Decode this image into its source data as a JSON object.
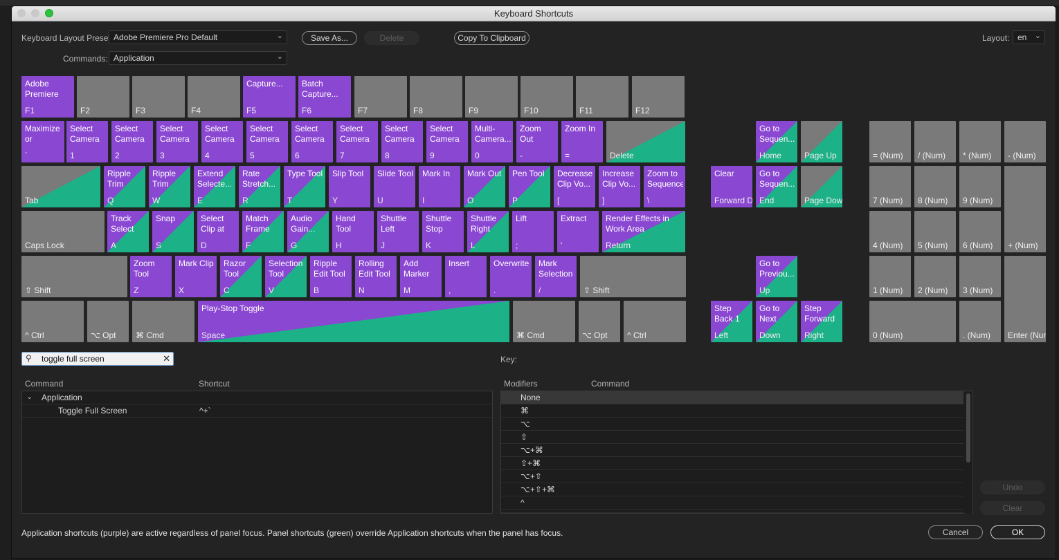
{
  "window": {
    "title": "Keyboard Shortcuts"
  },
  "toolbar": {
    "preset_label": "Keyboard Layout Preset:",
    "preset_value": "Adobe Premiere Pro Default",
    "commands_label": "Commands:",
    "commands_value": "Application",
    "save_as": "Save As...",
    "delete": "Delete",
    "copy_to_clipboard": "Copy To Clipboard",
    "layout_label": "Layout:",
    "layout_value": "en"
  },
  "colors": {
    "application": "#8a47d2",
    "panel": "#1cb187",
    "unassigned": "#7a7a7a"
  },
  "keys": [
    {
      "cmd": "Adobe Premiere",
      "label": "F1",
      "type": "app"
    },
    {
      "cmd": "",
      "label": "F2",
      "type": "none"
    },
    {
      "cmd": "",
      "label": "F3",
      "type": "none"
    },
    {
      "cmd": "",
      "label": "F4",
      "type": "none"
    },
    {
      "cmd": "Capture...",
      "label": "F5",
      "type": "app"
    },
    {
      "cmd": "Batch Capture...",
      "label": "F6",
      "type": "app"
    },
    {
      "cmd": "",
      "label": "F7",
      "type": "none"
    },
    {
      "cmd": "",
      "label": "F8",
      "type": "none"
    },
    {
      "cmd": "",
      "label": "F9",
      "type": "none"
    },
    {
      "cmd": "",
      "label": "F10",
      "type": "none"
    },
    {
      "cmd": "",
      "label": "F11",
      "type": "none"
    },
    {
      "cmd": "",
      "label": "F12",
      "type": "none"
    },
    {
      "cmd": "Maximize or",
      "label": "`",
      "type": "app"
    },
    {
      "cmd": "Select Camera 1",
      "label": "1",
      "type": "app"
    },
    {
      "cmd": "Select Camera 2",
      "label": "2",
      "type": "app"
    },
    {
      "cmd": "Select Camera 3",
      "label": "3",
      "type": "app"
    },
    {
      "cmd": "Select Camera 4",
      "label": "4",
      "type": "app"
    },
    {
      "cmd": "Select Camera 5",
      "label": "5",
      "type": "app"
    },
    {
      "cmd": "Select Camera 6",
      "label": "6",
      "type": "app"
    },
    {
      "cmd": "Select Camera 7",
      "label": "7",
      "type": "app"
    },
    {
      "cmd": "Select Camera 8",
      "label": "8",
      "type": "app"
    },
    {
      "cmd": "Select Camera 9",
      "label": "9",
      "type": "app"
    },
    {
      "cmd": "Multi-Camera...",
      "label": "0",
      "type": "app"
    },
    {
      "cmd": "Zoom Out",
      "label": "-",
      "type": "app"
    },
    {
      "cmd": "Zoom In",
      "label": "=",
      "type": "app"
    },
    {
      "cmd": "",
      "label": "Delete",
      "type": "panel"
    },
    {
      "cmd": "",
      "label": "Tab",
      "type": "panel"
    },
    {
      "cmd": "Ripple Trim",
      "label": "Q",
      "type": "mixed"
    },
    {
      "cmd": "Ripple Trim",
      "label": "W",
      "type": "mixed"
    },
    {
      "cmd": "Extend Selecte...",
      "label": "E",
      "type": "mixed"
    },
    {
      "cmd": "Rate Stretch...",
      "label": "R",
      "type": "mixed"
    },
    {
      "cmd": "Type Tool",
      "label": "T",
      "type": "mixed"
    },
    {
      "cmd": "Slip Tool",
      "label": "Y",
      "type": "app"
    },
    {
      "cmd": "Slide Tool",
      "label": "U",
      "type": "app"
    },
    {
      "cmd": "Mark In",
      "label": "I",
      "type": "app"
    },
    {
      "cmd": "Mark Out",
      "label": "O",
      "type": "mixed"
    },
    {
      "cmd": "Pen Tool",
      "label": "P",
      "type": "mixed"
    },
    {
      "cmd": "Decrease Clip Vo...",
      "label": "[",
      "type": "app"
    },
    {
      "cmd": "Increase Clip Vo...",
      "label": "]",
      "type": "app"
    },
    {
      "cmd": "Zoom to Sequence",
      "label": "\\",
      "type": "app"
    },
    {
      "cmd": "",
      "label": "Caps Lock",
      "type": "none"
    },
    {
      "cmd": "Track Select F...",
      "label": "A",
      "type": "mixed"
    },
    {
      "cmd": "Snap",
      "label": "S",
      "type": "mixed"
    },
    {
      "cmd": "Select Clip at P...",
      "label": "D",
      "type": "app"
    },
    {
      "cmd": "Match Frame",
      "label": "F",
      "type": "mixed"
    },
    {
      "cmd": "Audio Gain...",
      "label": "G",
      "type": "mixed"
    },
    {
      "cmd": "Hand Tool",
      "label": "H",
      "type": "app"
    },
    {
      "cmd": "Shuttle Left",
      "label": "J",
      "type": "app"
    },
    {
      "cmd": "Shuttle Stop",
      "label": "K",
      "type": "app"
    },
    {
      "cmd": "Shuttle Right",
      "label": "L",
      "type": "mixed"
    },
    {
      "cmd": "Lift",
      "label": ";",
      "type": "app"
    },
    {
      "cmd": "Extract",
      "label": "'",
      "type": "app"
    },
    {
      "cmd": "Render Effects in Work Area",
      "label": "Return",
      "type": "mixed"
    },
    {
      "cmd": "",
      "label": "⇧ Shift",
      "type": "none"
    },
    {
      "cmd": "Zoom Tool",
      "label": "Z",
      "type": "app"
    },
    {
      "cmd": "Mark Clip",
      "label": "X",
      "type": "app"
    },
    {
      "cmd": "Razor Tool",
      "label": "C",
      "type": "mixed"
    },
    {
      "cmd": "Selection Tool",
      "label": "V",
      "type": "mixed"
    },
    {
      "cmd": "Ripple Edit Tool",
      "label": "B",
      "type": "app"
    },
    {
      "cmd": "Rolling Edit Tool",
      "label": "N",
      "type": "app"
    },
    {
      "cmd": "Add Marker",
      "label": "M",
      "type": "app"
    },
    {
      "cmd": "Insert",
      "label": ",",
      "type": "app"
    },
    {
      "cmd": "Overwrite",
      "label": ".",
      "type": "app"
    },
    {
      "cmd": "Mark Selection",
      "label": "/",
      "type": "app"
    },
    {
      "cmd": "",
      "label": "⇧ Shift",
      "type": "none"
    },
    {
      "cmd": "",
      "label": "^ Ctrl",
      "type": "none"
    },
    {
      "cmd": "",
      "label": "⌥ Opt",
      "type": "none"
    },
    {
      "cmd": "",
      "label": "⌘ Cmd",
      "type": "none"
    },
    {
      "cmd": "Play-Stop Toggle",
      "label": "Space",
      "type": "mixed"
    },
    {
      "cmd": "",
      "label": "⌘ Cmd",
      "type": "none"
    },
    {
      "cmd": "",
      "label": "⌥ Opt",
      "type": "none"
    },
    {
      "cmd": "",
      "label": "^ Ctrl",
      "type": "none"
    },
    {
      "cmd": "Go to Sequen...",
      "label": "Home",
      "type": "mixed"
    },
    {
      "cmd": "",
      "label": "Page Up",
      "type": "panel"
    },
    {
      "cmd": "Clear",
      "label": "Forward Delete",
      "type": "app"
    },
    {
      "cmd": "Go to Sequen...",
      "label": "End",
      "type": "mixed"
    },
    {
      "cmd": "",
      "label": "Page Down",
      "type": "panel"
    },
    {
      "cmd": "Go to Previou...",
      "label": "Up",
      "type": "mixed"
    },
    {
      "cmd": "Step Back 1 Frame",
      "label": "Left",
      "type": "mixed"
    },
    {
      "cmd": "Go to Next",
      "label": "Down",
      "type": "mixed"
    },
    {
      "cmd": "Step Forward",
      "label": "Right",
      "type": "mixed"
    },
    {
      "cmd": "",
      "label": "= (Num)",
      "type": "none"
    },
    {
      "cmd": "",
      "label": "/ (Num)",
      "type": "none"
    },
    {
      "cmd": "",
      "label": "* (Num)",
      "type": "none"
    },
    {
      "cmd": "",
      "label": "- (Num)",
      "type": "none"
    },
    {
      "cmd": "",
      "label": "7 (Num)",
      "type": "none"
    },
    {
      "cmd": "",
      "label": "8 (Num)",
      "type": "none"
    },
    {
      "cmd": "",
      "label": "9 (Num)",
      "type": "none"
    },
    {
      "cmd": "",
      "label": "+ (Num)",
      "type": "none"
    },
    {
      "cmd": "",
      "label": "4 (Num)",
      "type": "none"
    },
    {
      "cmd": "",
      "label": "5 (Num)",
      "type": "none"
    },
    {
      "cmd": "",
      "label": "6 (Num)",
      "type": "none"
    },
    {
      "cmd": "",
      "label": "1 (Num)",
      "type": "none"
    },
    {
      "cmd": "",
      "label": "2 (Num)",
      "type": "none"
    },
    {
      "cmd": "",
      "label": "3 (Num)",
      "type": "none"
    },
    {
      "cmd": "",
      "label": "Enter (Num)",
      "type": "none"
    },
    {
      "cmd": "",
      "label": "0 (Num)",
      "type": "none"
    },
    {
      "cmd": "",
      "label": ". (Num)",
      "type": "none"
    }
  ],
  "search": {
    "value": "toggle full screen",
    "icon": "search-icon",
    "clear_icon": "close-icon"
  },
  "commands_table": {
    "col_command": "Command",
    "col_shortcut": "Shortcut",
    "group": "Application",
    "item": "Toggle Full Screen",
    "item_shortcut": "^+`"
  },
  "key_panel": {
    "key_label": "Key:",
    "col_modifiers": "Modifiers",
    "col_command": "Command",
    "modifiers": [
      "None",
      "⌘",
      "⌥",
      "⇧",
      "⌥+⌘",
      "⇧+⌘",
      "⌥+⇧",
      "⌥+⇧+⌘",
      "^",
      "^+⌘"
    ]
  },
  "side_buttons": {
    "undo": "Undo",
    "clear": "Clear"
  },
  "footer": {
    "note": "Application shortcuts (purple) are active regardless of panel focus. Panel shortcuts (green) override Application shortcuts when the panel has focus.",
    "cancel": "Cancel",
    "ok": "OK"
  }
}
